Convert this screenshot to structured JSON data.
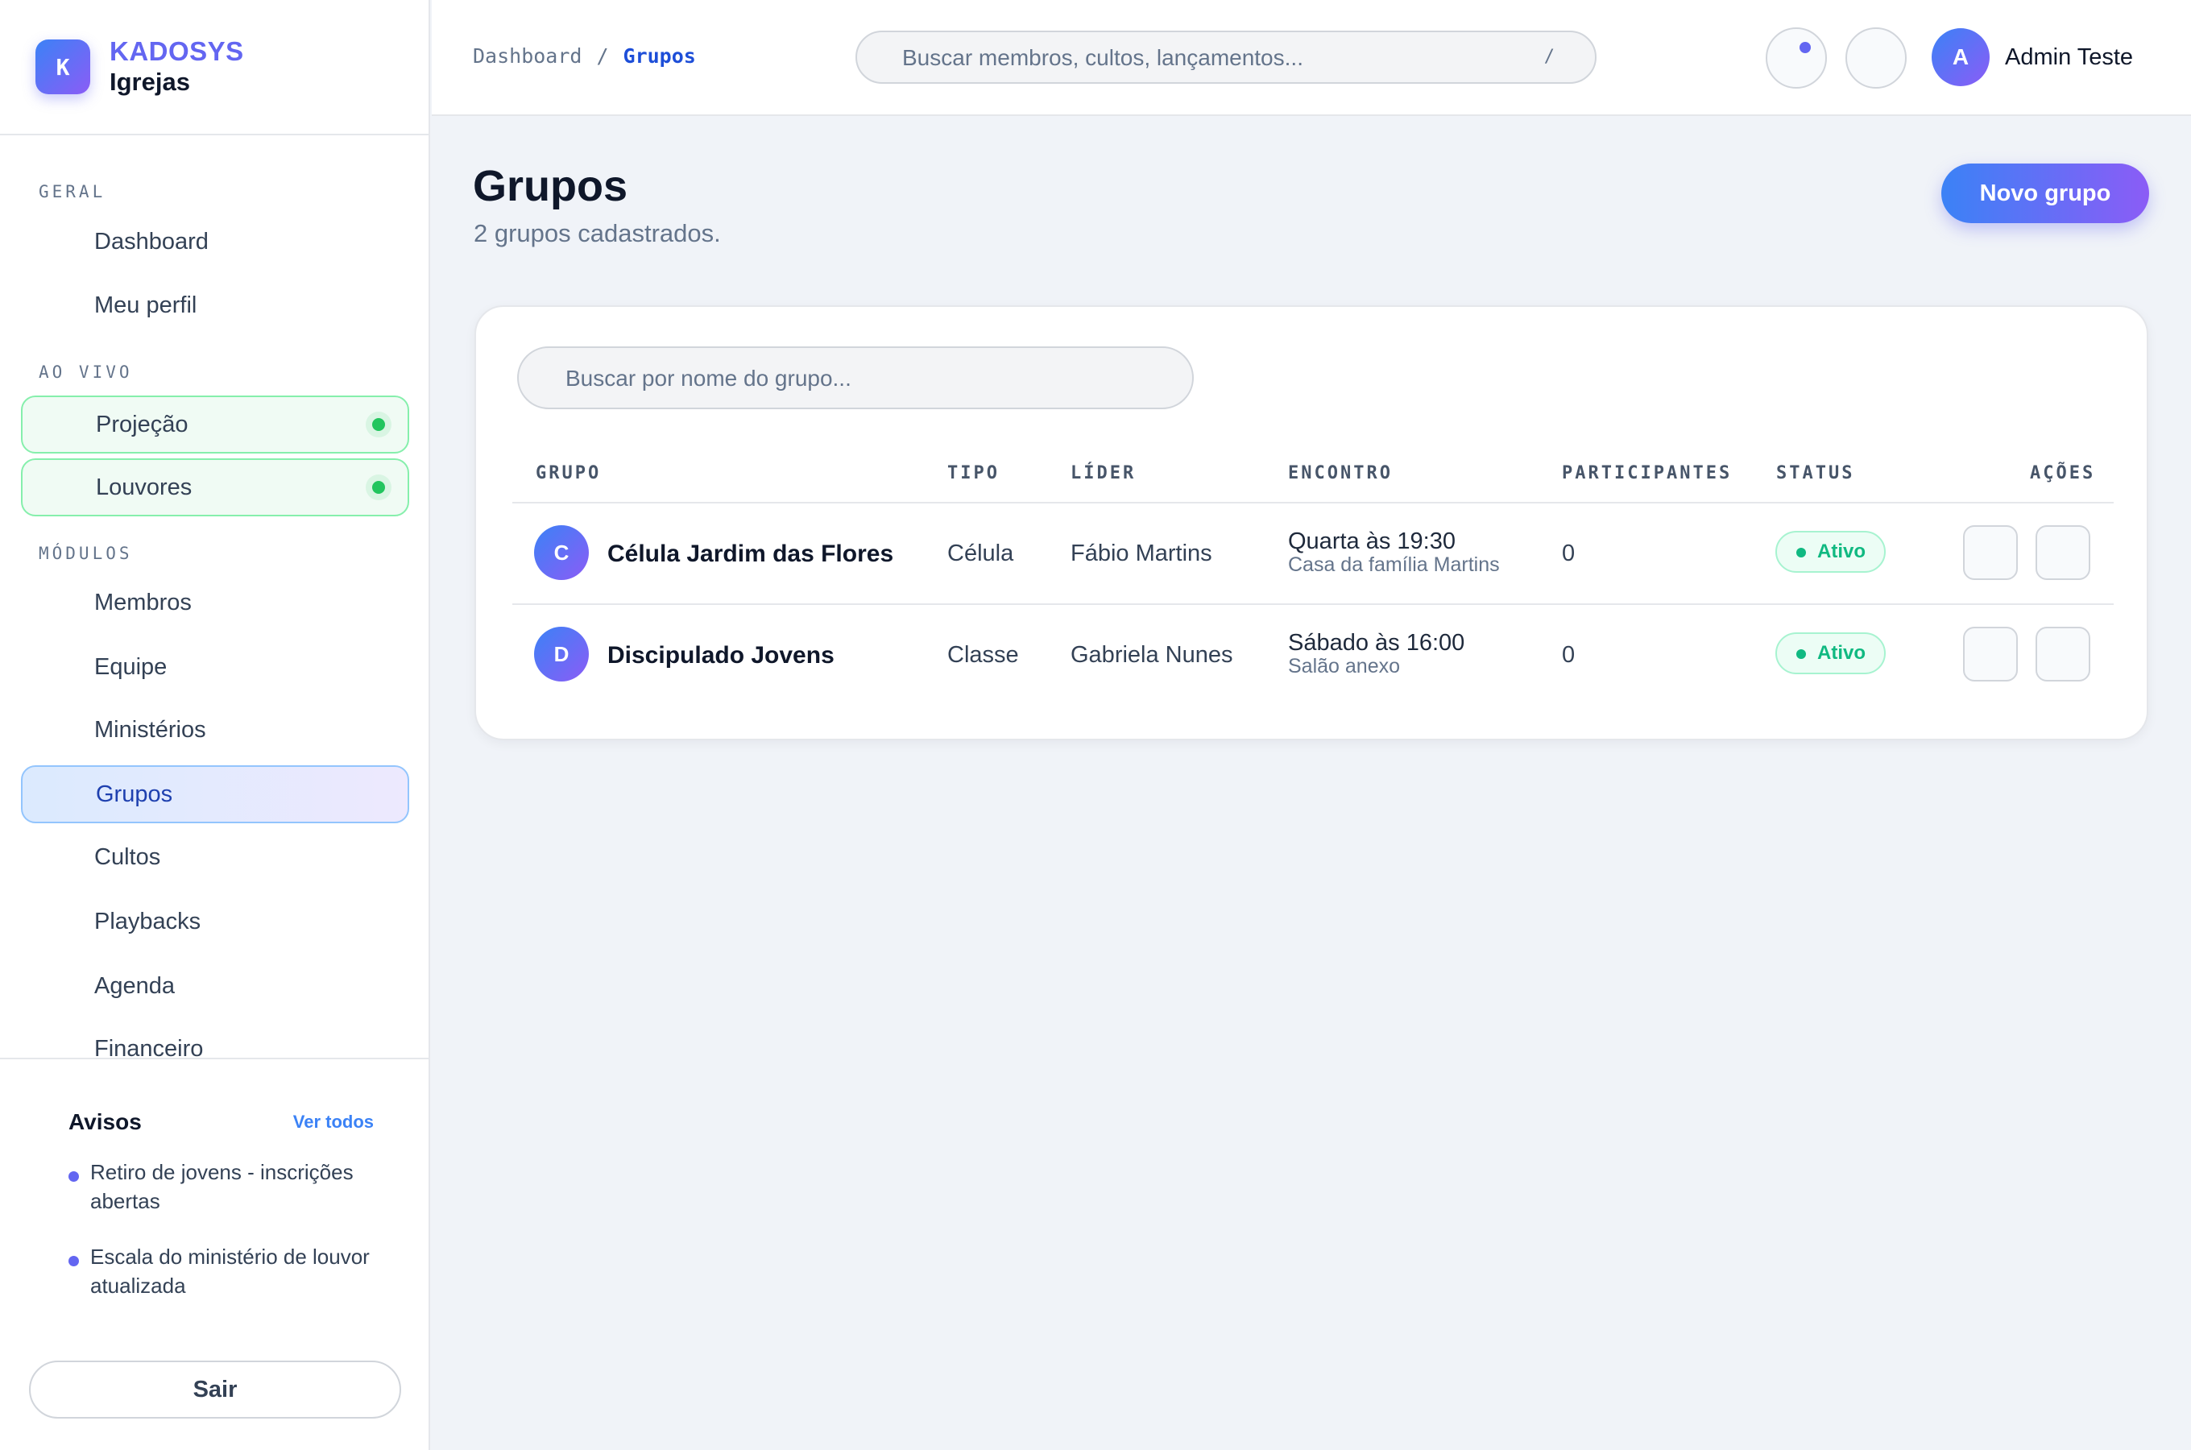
{
  "brand": {
    "logo_letter": "K",
    "name": "KADOSYS",
    "subtitle": "Igrejas"
  },
  "sidebar": {
    "sections": {
      "geral": "GERAL",
      "ao_vivo": "AO VIVO",
      "modulos": "MÓDULOS"
    },
    "geral": [
      "Dashboard",
      "Meu perfil"
    ],
    "ao_vivo": [
      "Projeção",
      "Louvores"
    ],
    "modulos": [
      "Membros",
      "Equipe",
      "Ministérios",
      "Grupos",
      "Cultos",
      "Playbacks",
      "Agenda",
      "Financeiro"
    ],
    "active_item": "Grupos"
  },
  "avisos": {
    "title": "Avisos",
    "link": "Ver todos",
    "items": [
      "Retiro de jovens - inscrições abertas",
      "Escala do ministério de louvor atualizada"
    ]
  },
  "logout_label": "Sair",
  "header": {
    "breadcrumb": {
      "root": "Dashboard",
      "separator": "/",
      "current": "Grupos"
    },
    "search_placeholder": "Buscar membros, cultos, lançamentos...",
    "search_shortcut": "/",
    "user": {
      "initial": "A",
      "name": "Admin Teste"
    }
  },
  "page": {
    "title": "Grupos",
    "subtitle": "2 grupos cadastrados.",
    "new_button": "Novo grupo",
    "search_placeholder": "Buscar por nome do grupo..."
  },
  "table": {
    "columns": [
      "GRUPO",
      "TIPO",
      "LÍDER",
      "ENCONTRO",
      "PARTICIPANTES",
      "STATUS",
      "AÇÕES"
    ],
    "rows": [
      {
        "initial": "C",
        "name": "Célula Jardim das Flores",
        "tipo": "Célula",
        "lider": "Fábio Martins",
        "encontro": "Quarta às 19:30",
        "local": "Casa da família Martins",
        "participantes": "0",
        "status": "Ativo"
      },
      {
        "initial": "D",
        "name": "Discipulado Jovens",
        "tipo": "Classe",
        "lider": "Gabriela Nunes",
        "encontro": "Sábado às 16:00",
        "local": "Salão anexo",
        "participantes": "0",
        "status": "Ativo"
      }
    ]
  },
  "colors": {
    "accent": "#6366f1",
    "brand_gradient_start": "#3b82f6",
    "brand_gradient_end": "#8b5cf6",
    "live": "#22c55e",
    "status_active": "#10b981"
  }
}
